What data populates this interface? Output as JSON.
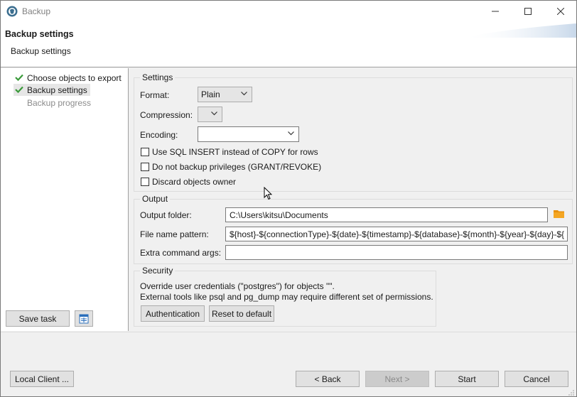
{
  "window": {
    "title": "Backup",
    "minimize_glyph": "—",
    "maximize_glyph": "☐",
    "close_glyph": "✕"
  },
  "header": {
    "title": "Backup settings",
    "subtitle": "Backup settings"
  },
  "nav": {
    "items": [
      {
        "label": "Choose objects to export",
        "state": "done"
      },
      {
        "label": "Backup settings",
        "state": "current"
      },
      {
        "label": "Backup progress",
        "state": "pending"
      }
    ]
  },
  "left_buttons": {
    "save_task": "Save task"
  },
  "settings": {
    "group_title": "Settings",
    "format_label": "Format:",
    "format_value": "Plain",
    "compression_label": "Compression:",
    "compression_value": "",
    "encoding_label": "Encoding:",
    "encoding_value": "",
    "checkboxes": [
      {
        "label": "Use SQL INSERT instead of COPY for rows",
        "checked": false
      },
      {
        "label": "Do not backup privileges (GRANT/REVOKE)",
        "checked": false
      },
      {
        "label": "Discard objects owner",
        "checked": false
      }
    ]
  },
  "output": {
    "group_title": "Output",
    "folder_label": "Output folder:",
    "folder_value": "C:\\Users\\kitsu\\Documents",
    "pattern_label": "File name pattern:",
    "pattern_value": "${host}-${connectionType}-${date}-${timestamp}-${database}-${month}-${year}-${day}-${",
    "extra_label": "Extra command args:",
    "extra_value": ""
  },
  "security": {
    "group_title": "Security",
    "line1": "Override user credentials (\"postgres\") for objects \"\".",
    "line2": "External tools like psql and pg_dump may require different set of permissions.",
    "auth_button": "Authentication",
    "reset_button": "Reset to default"
  },
  "footer": {
    "local_client": "Local Client ...",
    "back": "< Back",
    "next": "Next >",
    "start": "Start",
    "cancel": "Cancel"
  },
  "colors": {
    "check_green": "#3a9a3a",
    "folder_orange": "#e8910c",
    "accent_blue": "#0078d7"
  }
}
